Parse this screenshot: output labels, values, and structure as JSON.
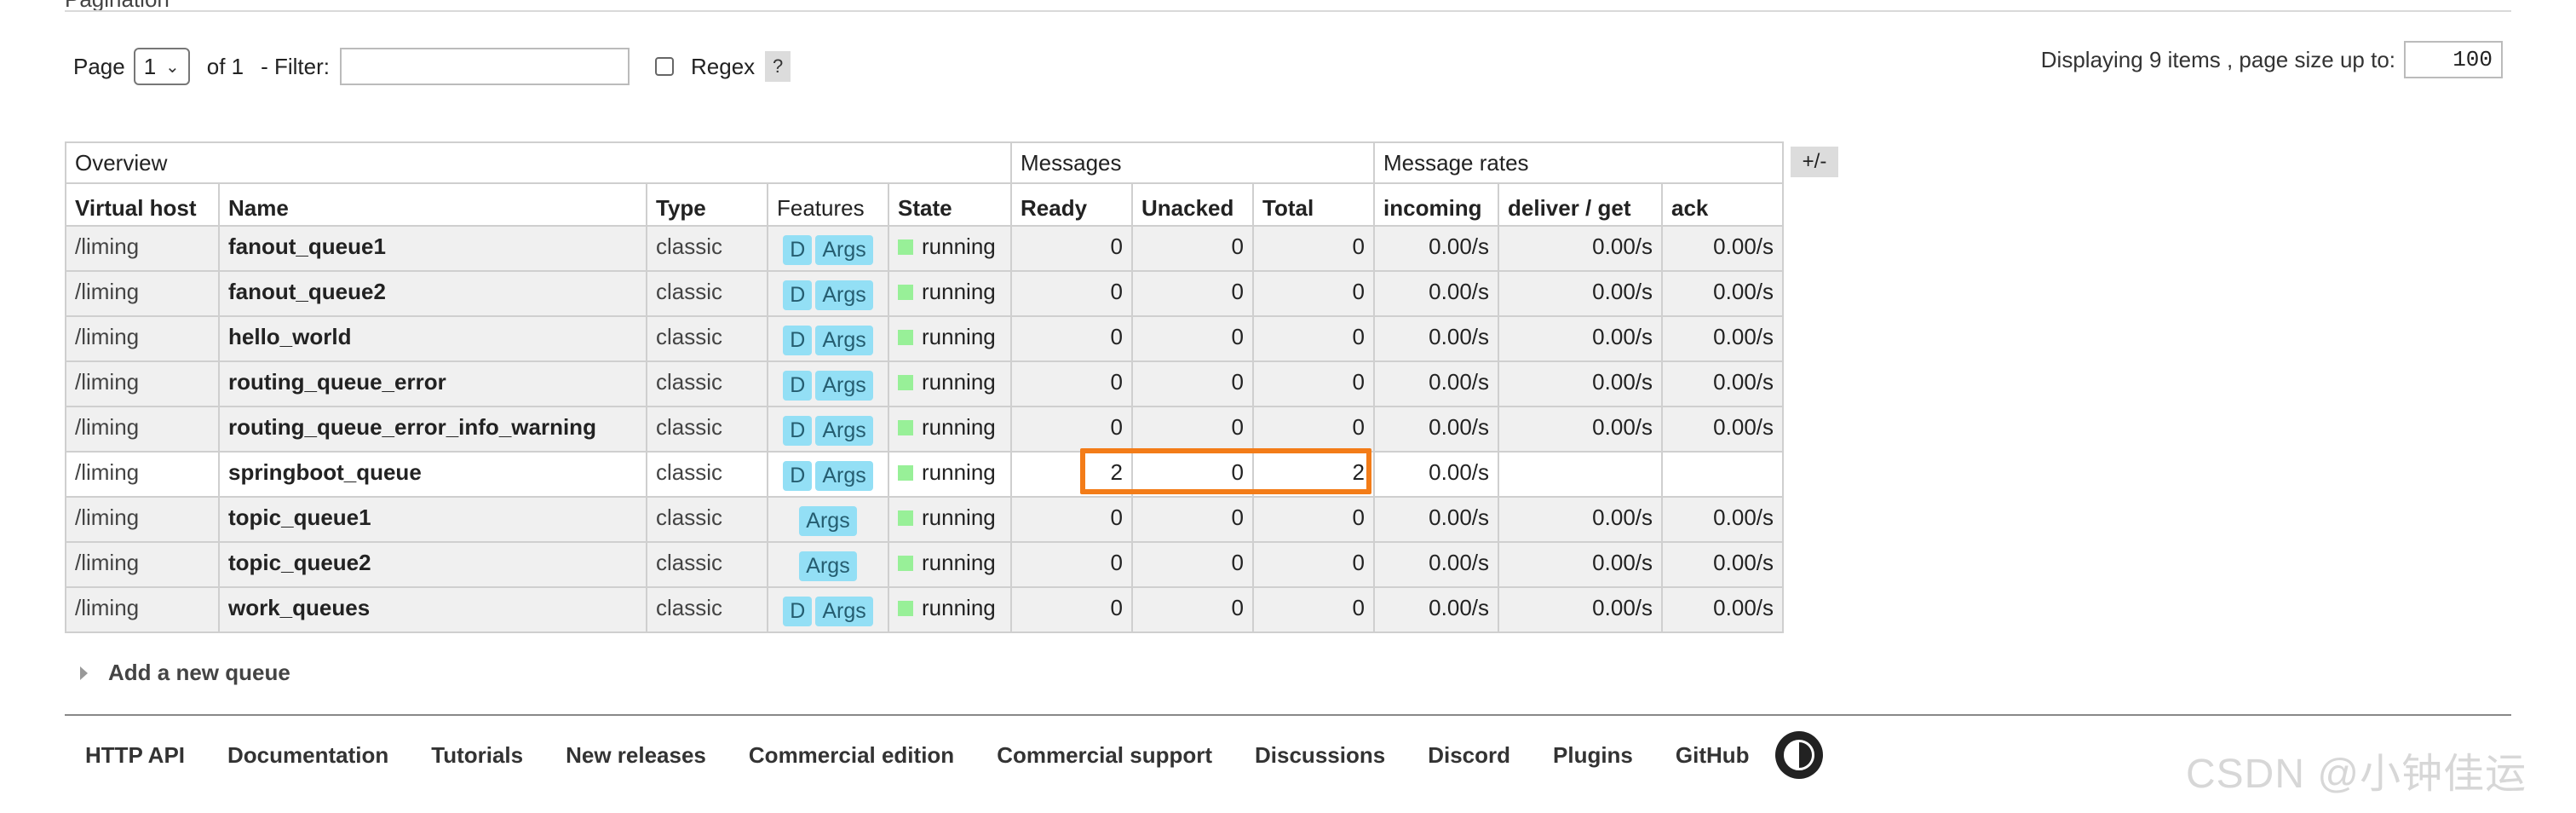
{
  "section_legend": "Pagination",
  "pagination": {
    "page_label": "Page",
    "page_value": "1",
    "of_label": "of 1",
    "filter_label": "- Filter:",
    "filter_value": "",
    "regex_label": "Regex",
    "help_label": "?",
    "display_text": "Displaying 9 items , page size up to:",
    "page_size": "100"
  },
  "table": {
    "groups": {
      "overview": "Overview",
      "messages": "Messages",
      "rates": "Message rates"
    },
    "columns": [
      "Virtual host",
      "Name",
      "Type",
      "Features",
      "State",
      "Ready",
      "Unacked",
      "Total",
      "incoming",
      "deliver / get",
      "ack"
    ],
    "rows": [
      {
        "vhost": "/liming",
        "name": "fanout_queue1",
        "type": "classic",
        "feat_d": "D",
        "feat_args": "Args",
        "state": "running",
        "ready": "0",
        "unacked": "0",
        "total": "0",
        "incoming": "0.00/s",
        "deliver": "0.00/s",
        "ack": "0.00/s"
      },
      {
        "vhost": "/liming",
        "name": "fanout_queue2",
        "type": "classic",
        "feat_d": "D",
        "feat_args": "Args",
        "state": "running",
        "ready": "0",
        "unacked": "0",
        "total": "0",
        "incoming": "0.00/s",
        "deliver": "0.00/s",
        "ack": "0.00/s"
      },
      {
        "vhost": "/liming",
        "name": "hello_world",
        "type": "classic",
        "feat_d": "D",
        "feat_args": "Args",
        "state": "running",
        "ready": "0",
        "unacked": "0",
        "total": "0",
        "incoming": "0.00/s",
        "deliver": "0.00/s",
        "ack": "0.00/s"
      },
      {
        "vhost": "/liming",
        "name": "routing_queue_error",
        "type": "classic",
        "feat_d": "D",
        "feat_args": "Args",
        "state": "running",
        "ready": "0",
        "unacked": "0",
        "total": "0",
        "incoming": "0.00/s",
        "deliver": "0.00/s",
        "ack": "0.00/s"
      },
      {
        "vhost": "/liming",
        "name": "routing_queue_error_info_warning",
        "type": "classic",
        "feat_d": "D",
        "feat_args": "Args",
        "state": "running",
        "ready": "0",
        "unacked": "0",
        "total": "0",
        "incoming": "0.00/s",
        "deliver": "0.00/s",
        "ack": "0.00/s"
      },
      {
        "vhost": "/liming",
        "name": "springboot_queue",
        "type": "classic",
        "feat_d": "D",
        "feat_args": "Args",
        "state": "running",
        "ready": "2",
        "unacked": "0",
        "total": "2",
        "incoming": "0.00/s",
        "deliver": "",
        "ack": ""
      },
      {
        "vhost": "/liming",
        "name": "topic_queue1",
        "type": "classic",
        "feat_d": "",
        "feat_args": "Args",
        "state": "running",
        "ready": "0",
        "unacked": "0",
        "total": "0",
        "incoming": "0.00/s",
        "deliver": "0.00/s",
        "ack": "0.00/s"
      },
      {
        "vhost": "/liming",
        "name": "topic_queue2",
        "type": "classic",
        "feat_d": "",
        "feat_args": "Args",
        "state": "running",
        "ready": "0",
        "unacked": "0",
        "total": "0",
        "incoming": "0.00/s",
        "deliver": "0.00/s",
        "ack": "0.00/s"
      },
      {
        "vhost": "/liming",
        "name": "work_queues",
        "type": "classic",
        "feat_d": "D",
        "feat_args": "Args",
        "state": "running",
        "ready": "0",
        "unacked": "0",
        "total": "0",
        "incoming": "0.00/s",
        "deliver": "0.00/s",
        "ack": "0.00/s"
      }
    ],
    "plus_minus": "+/-"
  },
  "add_queue_label": "Add a new queue",
  "footer_links": [
    "HTTP API",
    "Documentation",
    "Tutorials",
    "New releases",
    "Commercial edition",
    "Commercial support",
    "Discussions",
    "Discord",
    "Plugins",
    "GitHub"
  ],
  "watermark": "CSDN @小钟佳运",
  "colors": {
    "badge": "#93dff5",
    "running": "#98f098",
    "highlight": "#f37c18"
  }
}
